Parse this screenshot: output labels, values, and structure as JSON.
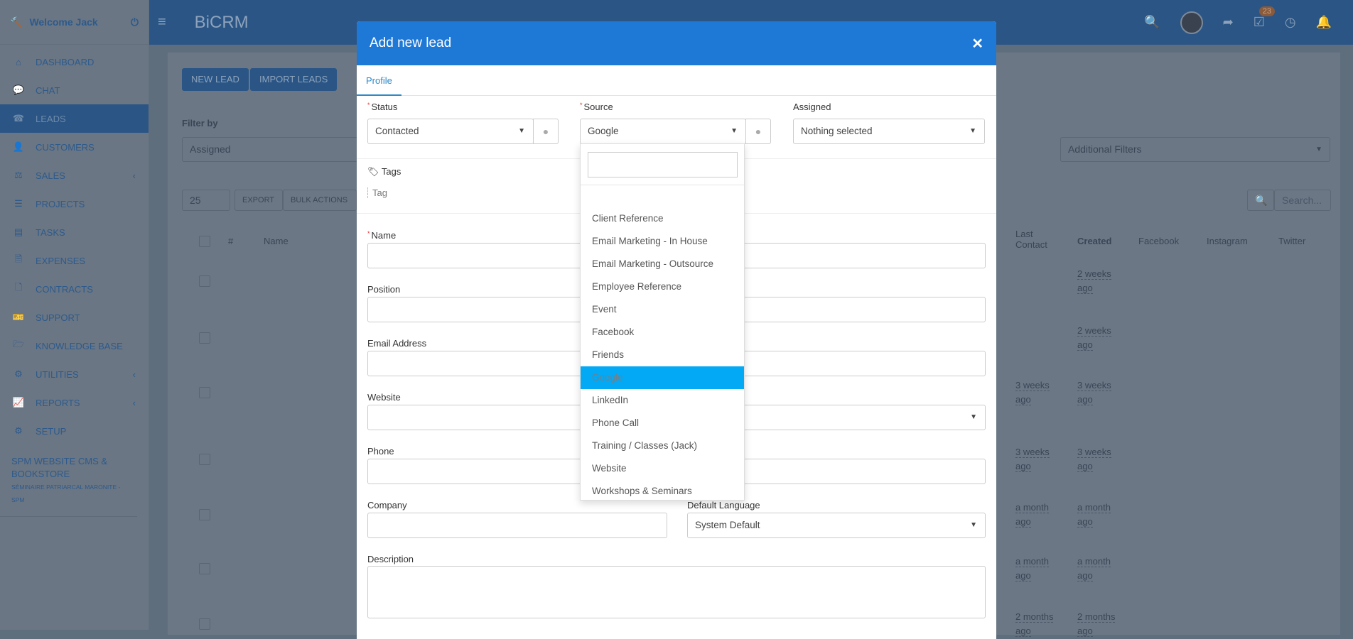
{
  "sidebar": {
    "welcome": "Welcome Jack",
    "items": [
      {
        "label": "DASHBOARD",
        "icon": "home-icon",
        "g": "⌂"
      },
      {
        "label": "CHAT",
        "icon": "chat-icon",
        "g": "💬"
      },
      {
        "label": "LEADS",
        "icon": "leads-icon",
        "g": "☎",
        "active": true
      },
      {
        "label": "CUSTOMERS",
        "icon": "user-icon",
        "g": "👤"
      },
      {
        "label": "SALES",
        "icon": "balance-icon",
        "g": "⚖",
        "chev": true
      },
      {
        "label": "PROJECTS",
        "icon": "bars-icon",
        "g": "☰"
      },
      {
        "label": "TASKS",
        "icon": "tasks-icon",
        "g": "▤"
      },
      {
        "label": "EXPENSES",
        "icon": "file-icon",
        "g": "🗎"
      },
      {
        "label": "CONTRACTS",
        "icon": "contract-icon",
        "g": "🗋"
      },
      {
        "label": "SUPPORT",
        "icon": "ticket-icon",
        "g": "🎫"
      },
      {
        "label": "KNOWLEDGE BASE",
        "icon": "folder-icon",
        "g": "🗁"
      },
      {
        "label": "UTILITIES",
        "icon": "cogs-icon",
        "g": "⚙",
        "chev": true
      },
      {
        "label": "REPORTS",
        "icon": "chart-icon",
        "g": "📈",
        "chev": true
      },
      {
        "label": "SETUP",
        "icon": "gear-icon",
        "g": "⚙"
      }
    ],
    "project_title": "SPM WEBSITE CMS & BOOKSTORE",
    "project_sub": "SÉMINAIRE PATRIARCAL MARONITE - SPM"
  },
  "header": {
    "brand": "BiCRM",
    "badge": "23"
  },
  "page": {
    "new_lead": "NEW LEAD",
    "import_leads": "IMPORT LEADS",
    "filter_by": "Filter by",
    "assigned": "Assigned",
    "additional_filters": "Additional Filters",
    "page_size": "25",
    "export": "EXPORT",
    "bulk_actions": "BULK ACTIONS",
    "search_placeholder": "Search...",
    "columns": {
      "hash": "#",
      "name": "Name",
      "last_contact": "Last Contact",
      "created": "Created",
      "facebook": "Facebook",
      "instagram": "Instagram",
      "twitter": "Twitter"
    },
    "rows": [
      {
        "last": "",
        "created": "2 weeks ago"
      },
      {
        "last": "",
        "created": "2 weeks ago"
      },
      {
        "last": "3 weeks ago",
        "created": "3 weeks ago"
      },
      {
        "last": "3 weeks ago",
        "created": "3 weeks ago"
      },
      {
        "last": "a month ago",
        "created": "a month ago"
      },
      {
        "last": "a month ago",
        "created": "a month ago"
      },
      {
        "last": "2 months ago",
        "created": "2 months ago"
      }
    ]
  },
  "modal": {
    "title": "Add new lead",
    "tab": "Profile",
    "status_label": "Status",
    "status_value": "Contacted",
    "source_label": "Source",
    "source_value": "Google",
    "assigned_label": "Assigned",
    "assigned_value": "Nothing selected",
    "tags_label": "Tags",
    "tag_placeholder": "Tag",
    "name_label": "Name",
    "position_label": "Position",
    "email_label": "Email Address",
    "website_label": "Website",
    "phone_label": "Phone",
    "company_label": "Company",
    "language_label": "Default Language",
    "language_value": "System Default",
    "description_label": "Description",
    "source_options": [
      "Client Reference",
      "Email Marketing - In House",
      "Email Marketing - Outsource",
      "Employee Reference",
      "Event",
      "Facebook",
      "Friends",
      "Google",
      "LinkedIn",
      "Phone Call",
      "Training / Classes (Jack)",
      "Website",
      "Workshops & Seminars"
    ],
    "source_selected": "Google"
  },
  "colors": {
    "primary": "#2d78c8",
    "modal_header": "#1e78d6",
    "highlight": "#03a9f4",
    "badge": "#e8843a"
  }
}
